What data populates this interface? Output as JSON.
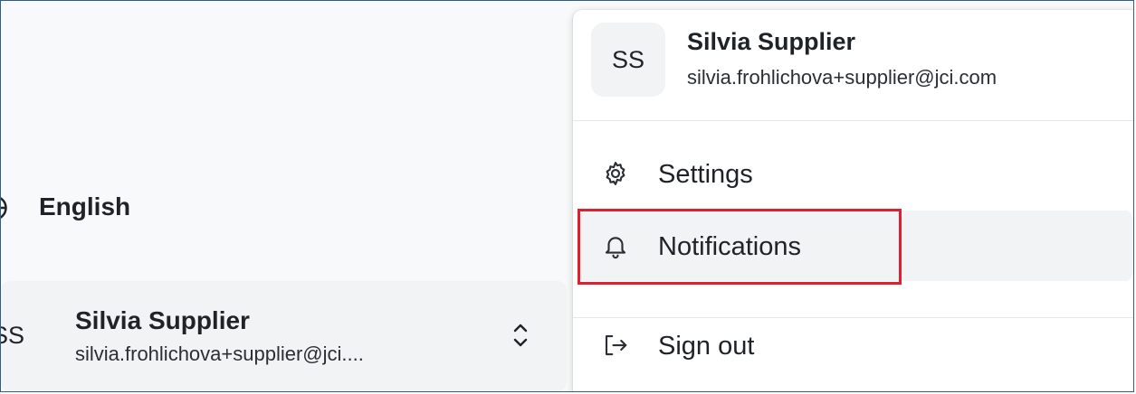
{
  "sidebar": {
    "language": {
      "icon": "globe-icon",
      "label": "English"
    },
    "user": {
      "initials": "SS",
      "name": "Silvia Supplier",
      "email": "silvia.frohlichova+supplier@jci....",
      "toggle_icon": "chevrons-up-down-icon"
    }
  },
  "user_menu": {
    "initials": "SS",
    "name": "Silvia Supplier",
    "email": "silvia.frohlichova+supplier@jci.com",
    "items": [
      {
        "icon": "gear-icon",
        "label": "Settings"
      },
      {
        "icon": "bell-icon",
        "label": "Notifications"
      },
      {
        "icon": "sign-out-icon",
        "label": "Sign out"
      }
    ]
  },
  "colors": {
    "highlight": "#e0202e",
    "frame_border": "#2e5f86"
  }
}
